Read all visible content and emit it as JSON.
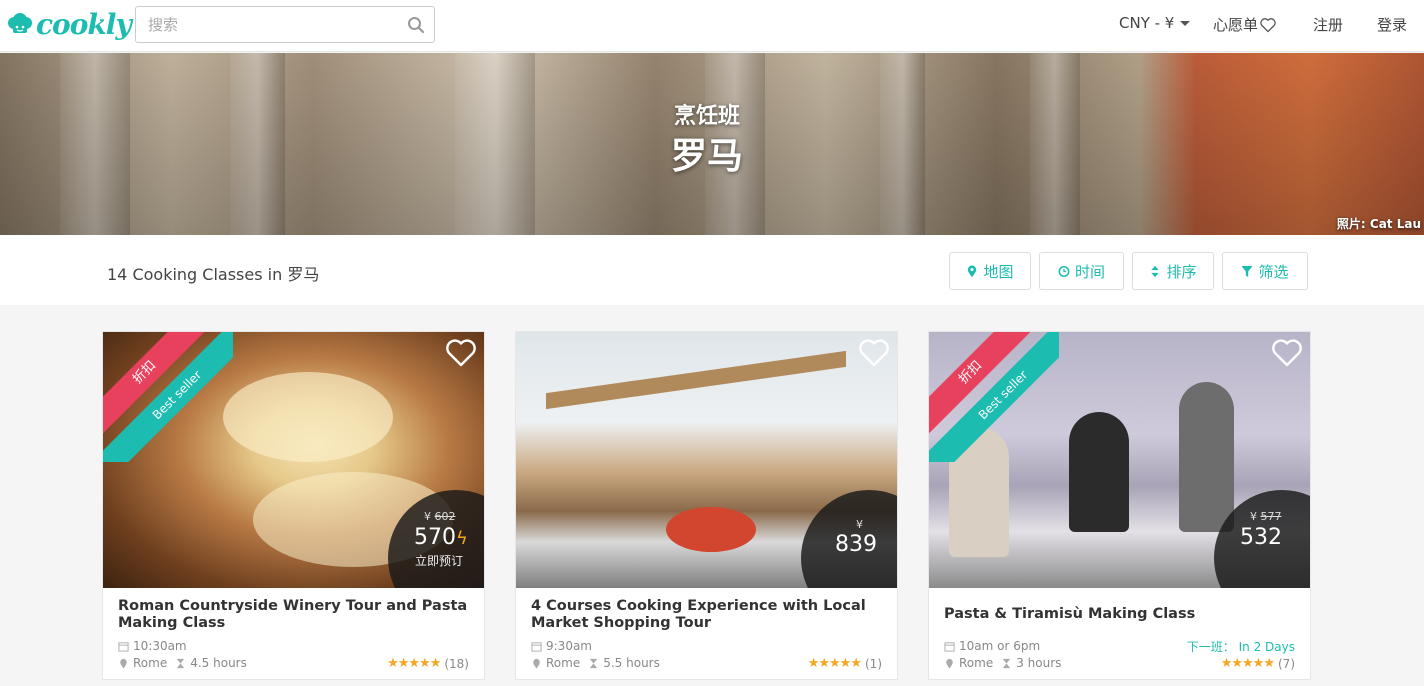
{
  "header": {
    "logo": "cookly",
    "search_placeholder": "搜索",
    "currency": "CNY - ¥",
    "wishlist": "心愿单",
    "signup": "注册",
    "login": "登录"
  },
  "hero": {
    "subtitle": "烹饪班",
    "title": "罗马",
    "credit": "照片: Cat Lau"
  },
  "filters": {
    "result_count": "14 Cooking Classes in 罗马",
    "map": "地图",
    "time": "时间",
    "sort": "排序",
    "filter": "筛选"
  },
  "colors": {
    "accent": "#1dbcb0",
    "ribbon_red": "#e8415e",
    "star": "#f5a623"
  },
  "cards": [
    {
      "title": "Roman Countryside Winery Tour and Pasta Making Class",
      "ribbon_top": "折扣",
      "ribbon_bottom": "Best seller",
      "currency": "¥",
      "old_price": "602",
      "price": "570",
      "book_now": "立即预订",
      "time": "10:30am",
      "location": "Rome",
      "duration": "4.5 hours",
      "stars": "★★★★★",
      "reviews": "(18)"
    },
    {
      "title": "4 Courses Cooking Experience with Local Market Shopping Tour",
      "currency": "¥",
      "price": "839",
      "time": "9:30am",
      "location": "Rome",
      "duration": "5.5 hours",
      "stars": "★★★★★",
      "reviews": "(1)"
    },
    {
      "title": "Pasta & Tiramisù Making Class",
      "ribbon_top": "折扣",
      "ribbon_bottom": "Best seller",
      "currency": "¥",
      "old_price": "577",
      "price": "532",
      "time": "10am or 6pm",
      "location": "Rome",
      "duration": "3 hours",
      "next_label": "下一班：",
      "next_value": "In 2 Days",
      "stars": "★★★★★",
      "reviews": "(7)"
    }
  ]
}
